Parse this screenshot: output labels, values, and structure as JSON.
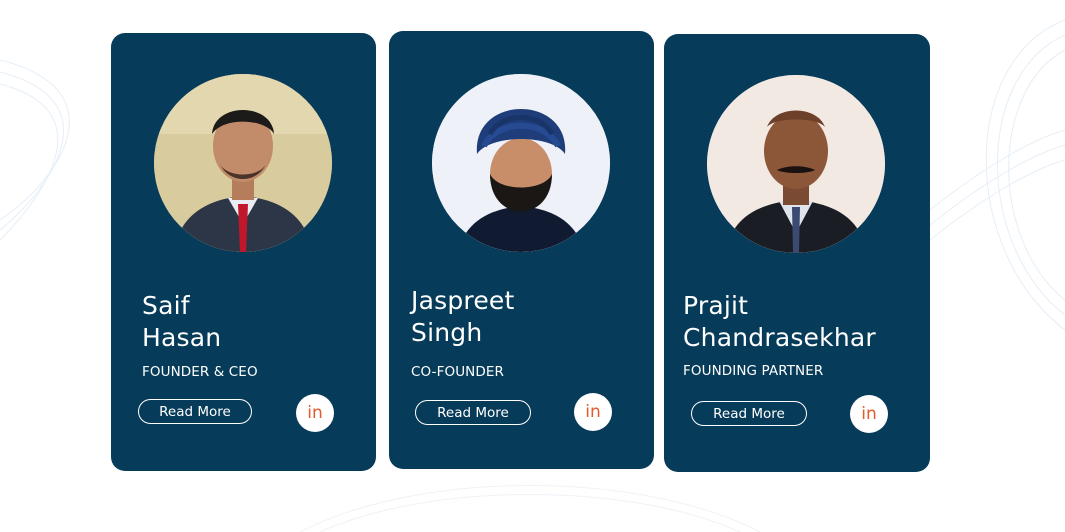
{
  "team": [
    {
      "name_line1": "Saif",
      "name_line2": "Hasan",
      "role": "FOUNDER & CEO",
      "read_more_label": "Read More",
      "linkedin_label": "in"
    },
    {
      "name_line1": "Jaspreet",
      "name_line2": "Singh",
      "role": "CO-FOUNDER",
      "read_more_label": "Read More",
      "linkedin_label": "in"
    },
    {
      "name_line1": "Prajit",
      "name_line2": "Chandrasekhar",
      "role": "FOUNDING PARTNER",
      "read_more_label": "Read More",
      "linkedin_label": "in"
    }
  ],
  "colors": {
    "card_background": "#063b59",
    "linkedin_accent": "#e55a2b",
    "text": "#ffffff"
  },
  "icons": {
    "linkedin": "linkedin-icon"
  }
}
